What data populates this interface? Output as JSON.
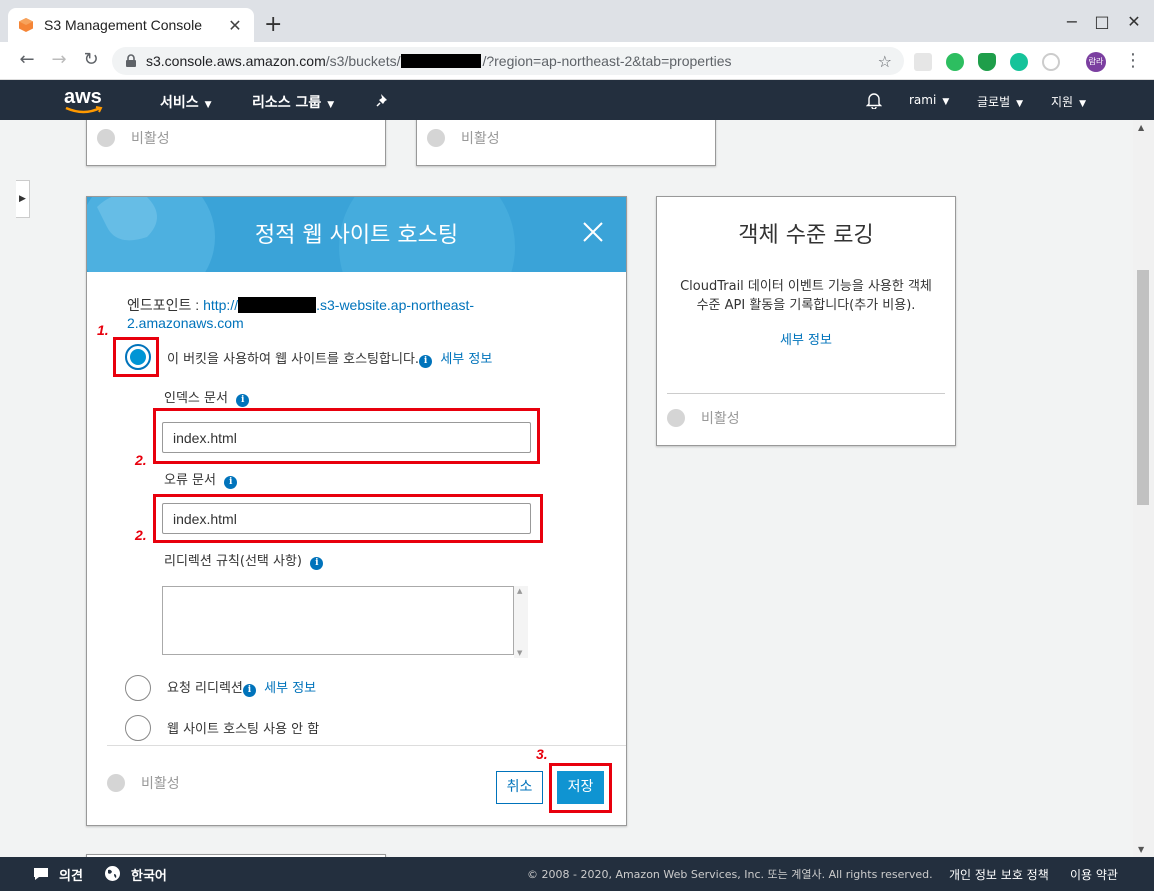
{
  "browser": {
    "tab_title": "S3 Management Console",
    "url_host": "s3.console.aws.amazon.com",
    "url_path_prefix": "/s3/buckets/",
    "url_query": "/?region=ap-northeast-2&tab=properties",
    "profile_initials": "람라"
  },
  "aws_nav": {
    "logo": "aws",
    "services": "서비스",
    "resource_groups": "리소스 그룹",
    "user": "rami",
    "region": "글로벌",
    "support": "지원"
  },
  "top_cards": {
    "left_status": "비활성",
    "right_status": "비활성"
  },
  "modal": {
    "title": "정적 웹 사이트 호스팅",
    "endpoint_label": "엔드포인트 : ",
    "endpoint_scheme": "http://",
    "endpoint_suffix": ".s3-website.ap-northeast-2.amazonaws.com",
    "option_host_label": "이 버킷을 사용하여 웹 사이트를 호스팅합니다.",
    "learn_more": "세부 정보",
    "index_doc_label": "인덱스 문서",
    "index_doc_value": "index.html",
    "error_doc_label": "오류 문서",
    "error_doc_value": "index.html",
    "redirect_rules_label": "리디렉션 규칙(선택 사항)",
    "option_redirect_label": "요청 리디렉션",
    "option_disable_label": "웹 사이트 호스팅 사용 안 함",
    "status": "비활성",
    "cancel": "취소",
    "save": "저장"
  },
  "annotations": {
    "step1": "1.",
    "step2a": "2.",
    "step2b": "2.",
    "step3": "3."
  },
  "logging_card": {
    "title": "객체 수준 로깅",
    "description": "CloudTrail 데이터 이벤트 기능을 사용한 객체 수준 API 활동을 기록합니다(추가 비용).",
    "learn_more": "세부 정보",
    "status": "비활성"
  },
  "footer": {
    "feedback": "의견",
    "language": "한국어",
    "copyright": "© 2008 - 2020, Amazon Web Services, Inc. 또는 계열사. All rights reserved.",
    "privacy": "개인 정보 보호 정책",
    "terms": "이용 약관"
  },
  "colors": {
    "aws_nav_bg": "#232f3e",
    "modal_header": "#3aa3d8",
    "link": "#0073bb",
    "annotation_red": "#e8000d",
    "primary_button": "#0f94d2"
  }
}
